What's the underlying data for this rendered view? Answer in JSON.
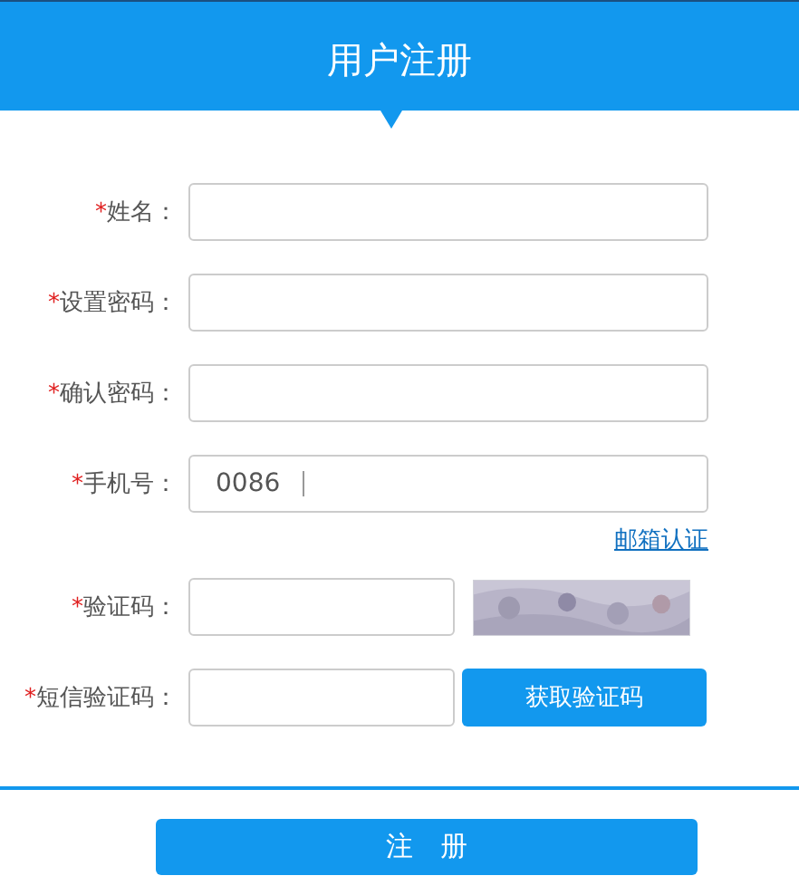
{
  "header": {
    "title": "用户注册"
  },
  "fields": [
    {
      "kind": "text",
      "mark": "*",
      "label": "姓名："
    },
    {
      "kind": "text",
      "mark": "*",
      "label": "设置密码："
    },
    {
      "kind": "text",
      "mark": "*",
      "label": "确认密码："
    },
    {
      "kind": "phone",
      "mark": "*",
      "label": "手机号：",
      "prefix": "0086"
    },
    {
      "kind": "link",
      "link": "邮箱认证"
    },
    {
      "kind": "captcha",
      "mark": "*",
      "label": "验证码："
    },
    {
      "kind": "sms",
      "mark": "*",
      "label": "短信验证码：",
      "button": "获取验证码"
    }
  ],
  "submit": "注　册"
}
